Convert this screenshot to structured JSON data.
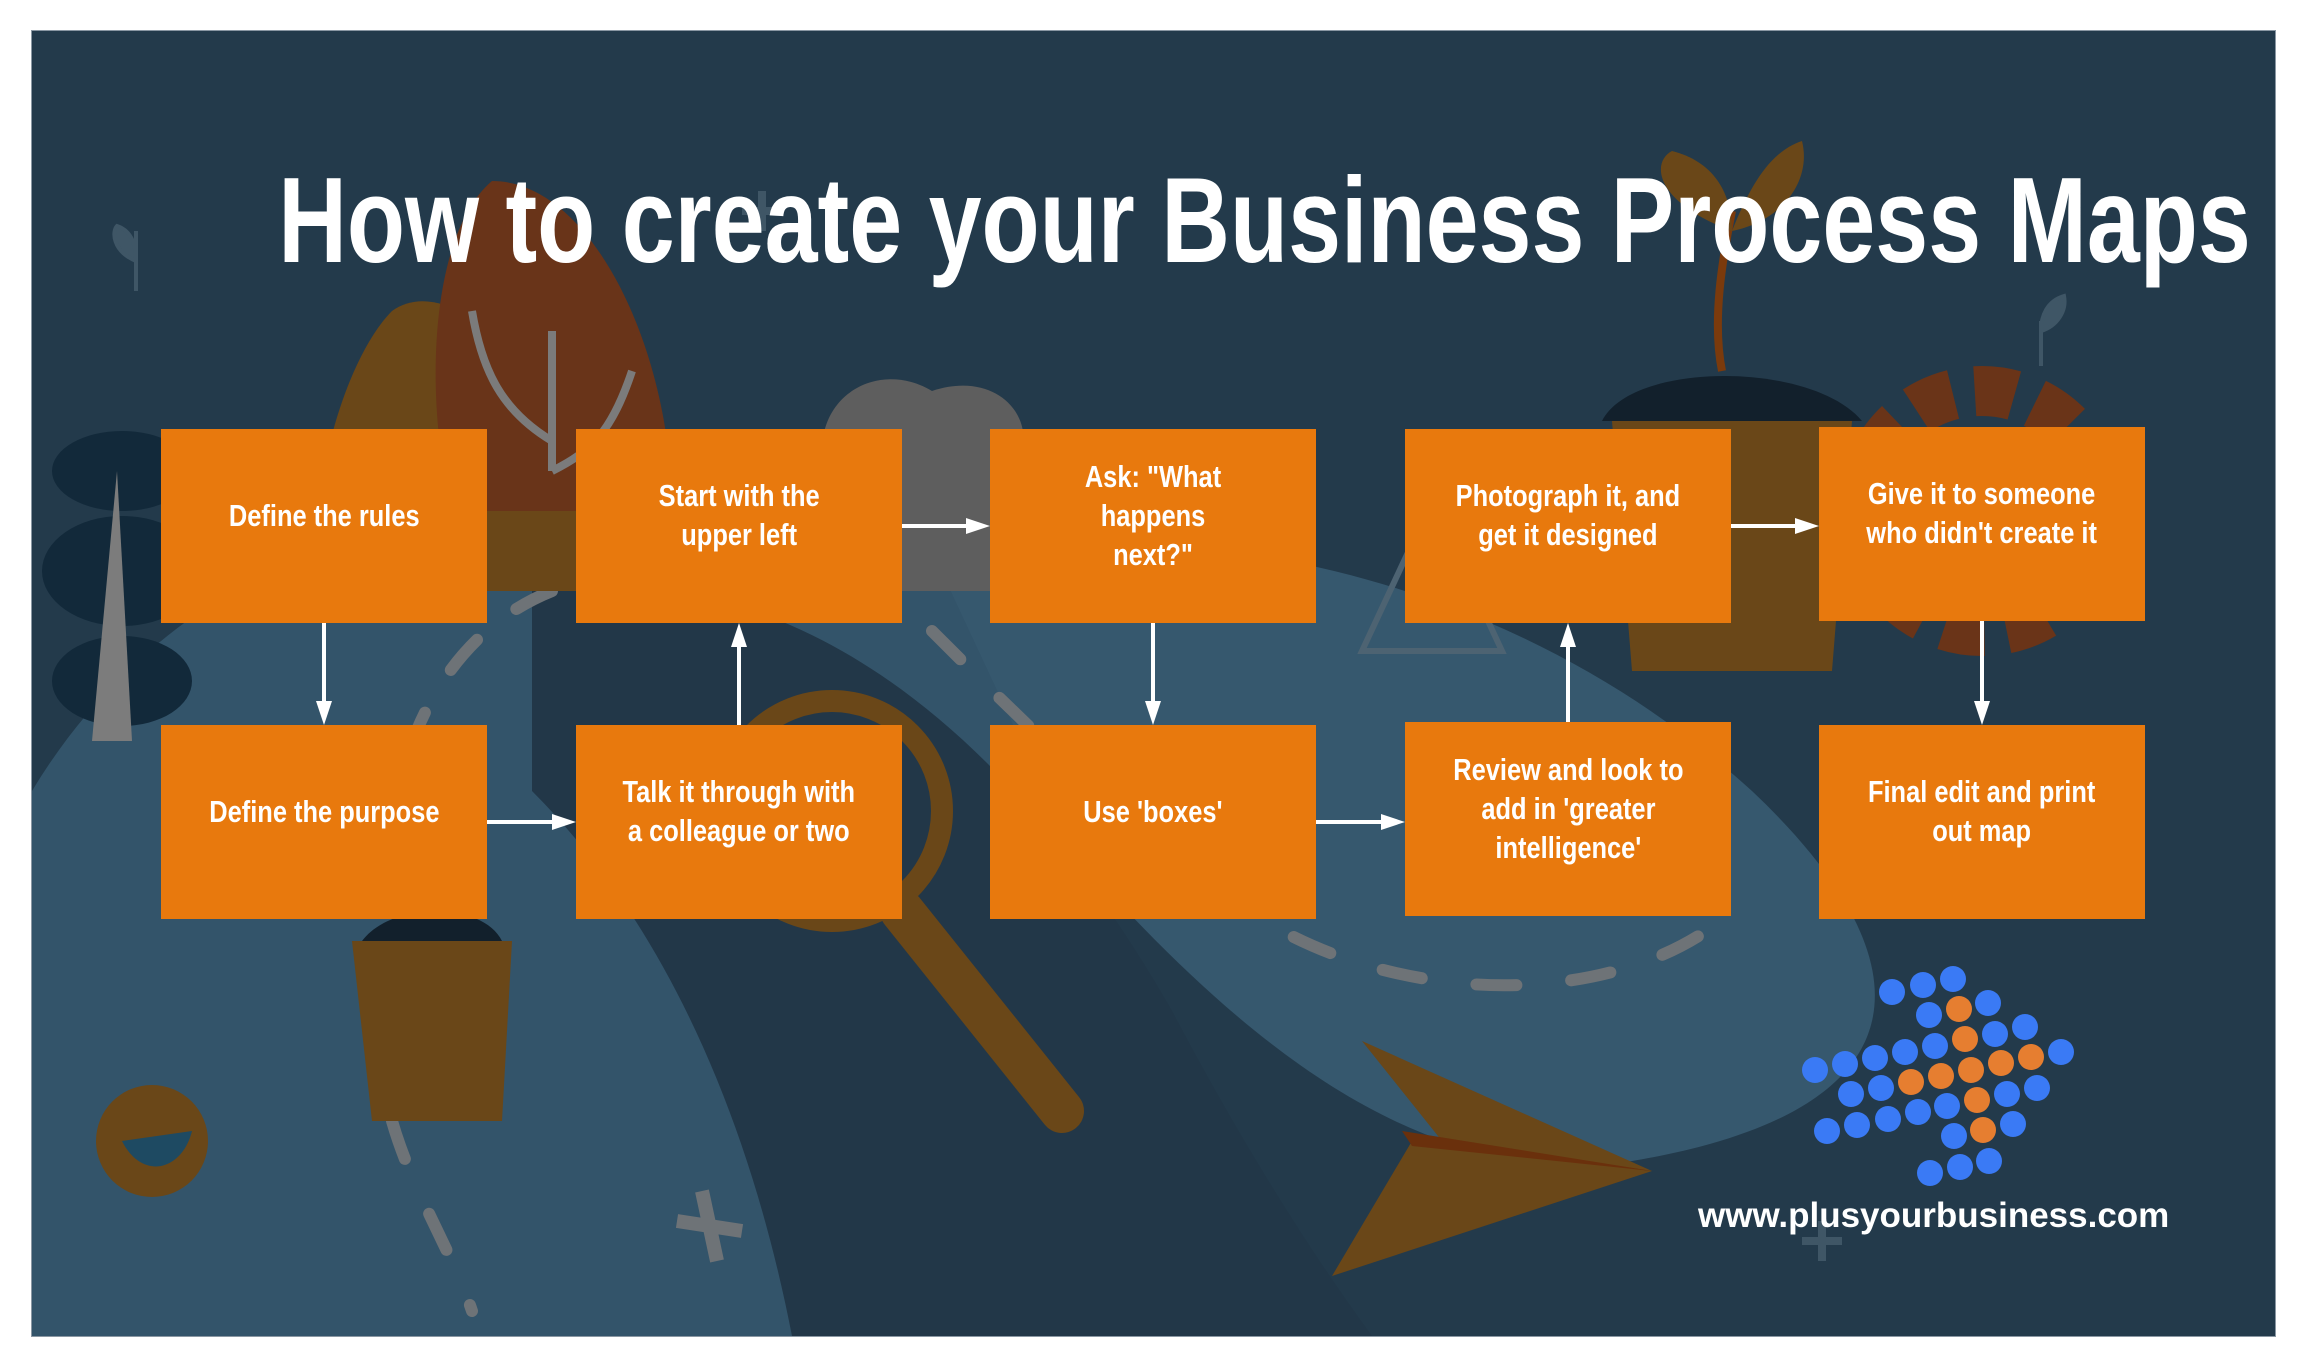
{
  "title": "How to create your Business Process Maps",
  "colors": {
    "panel_background": "#233a4b",
    "box_fill": "#e8790d",
    "box_text": "#ffffff",
    "arrow": "#ffffff",
    "logo_blue": "#3a7af5",
    "logo_orange": "#e67e30"
  },
  "steps": [
    {
      "id": "s1",
      "label": "Define the rules"
    },
    {
      "id": "s2",
      "label": "Define the purpose"
    },
    {
      "id": "s3",
      "label": "Talk it through with\na colleague or two"
    },
    {
      "id": "s4",
      "label": "Start with the\nupper left"
    },
    {
      "id": "s5",
      "label": "Ask: \"What happens\nnext?\""
    },
    {
      "id": "s6",
      "label": "Use 'boxes'"
    },
    {
      "id": "s7",
      "label": "Review and look to\nadd in 'greater\nintelligence'"
    },
    {
      "id": "s8",
      "label": "Photograph it, and\nget it designed"
    },
    {
      "id": "s9",
      "label": "Give it to someone\nwho didn't create it"
    },
    {
      "id": "s10",
      "label": "Final edit and print\nout map"
    }
  ],
  "flow": [
    {
      "from": "s1",
      "to": "s2"
    },
    {
      "from": "s2",
      "to": "s3"
    },
    {
      "from": "s3",
      "to": "s4"
    },
    {
      "from": "s4",
      "to": "s5"
    },
    {
      "from": "s5",
      "to": "s6"
    },
    {
      "from": "s6",
      "to": "s7"
    },
    {
      "from": "s7",
      "to": "s8"
    },
    {
      "from": "s8",
      "to": "s9"
    },
    {
      "from": "s9",
      "to": "s10"
    }
  ],
  "logo": {
    "name": "plusyourbusiness dots arrow logo"
  },
  "footer": {
    "url": "www.plusyourbusiness.com"
  }
}
